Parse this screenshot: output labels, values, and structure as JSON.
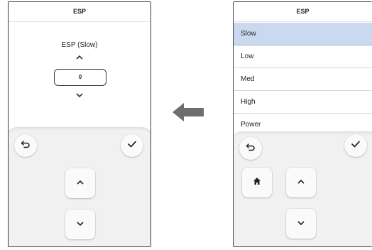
{
  "colors": {
    "selected_bg": "#c9daf0",
    "panel_bg": "#f1f1f1",
    "arrow": "#6e6e6e"
  },
  "left_screen": {
    "title": "ESP",
    "setting_label": "ESP (Slow)",
    "value": "0",
    "icons": [
      "chevron-up-icon",
      "chevron-down-icon",
      "back-icon",
      "check-icon"
    ]
  },
  "right_screen": {
    "title": "ESP",
    "items": [
      {
        "label": "Slow",
        "selected": true
      },
      {
        "label": "Low",
        "selected": false
      },
      {
        "label": "Med",
        "selected": false
      },
      {
        "label": "High",
        "selected": false
      },
      {
        "label": "Power",
        "selected": false
      }
    ],
    "icons": [
      "back-icon",
      "check-icon",
      "home-icon",
      "chevron-up-icon",
      "chevron-down-icon"
    ]
  },
  "transition_arrow": "arrow-left-icon"
}
